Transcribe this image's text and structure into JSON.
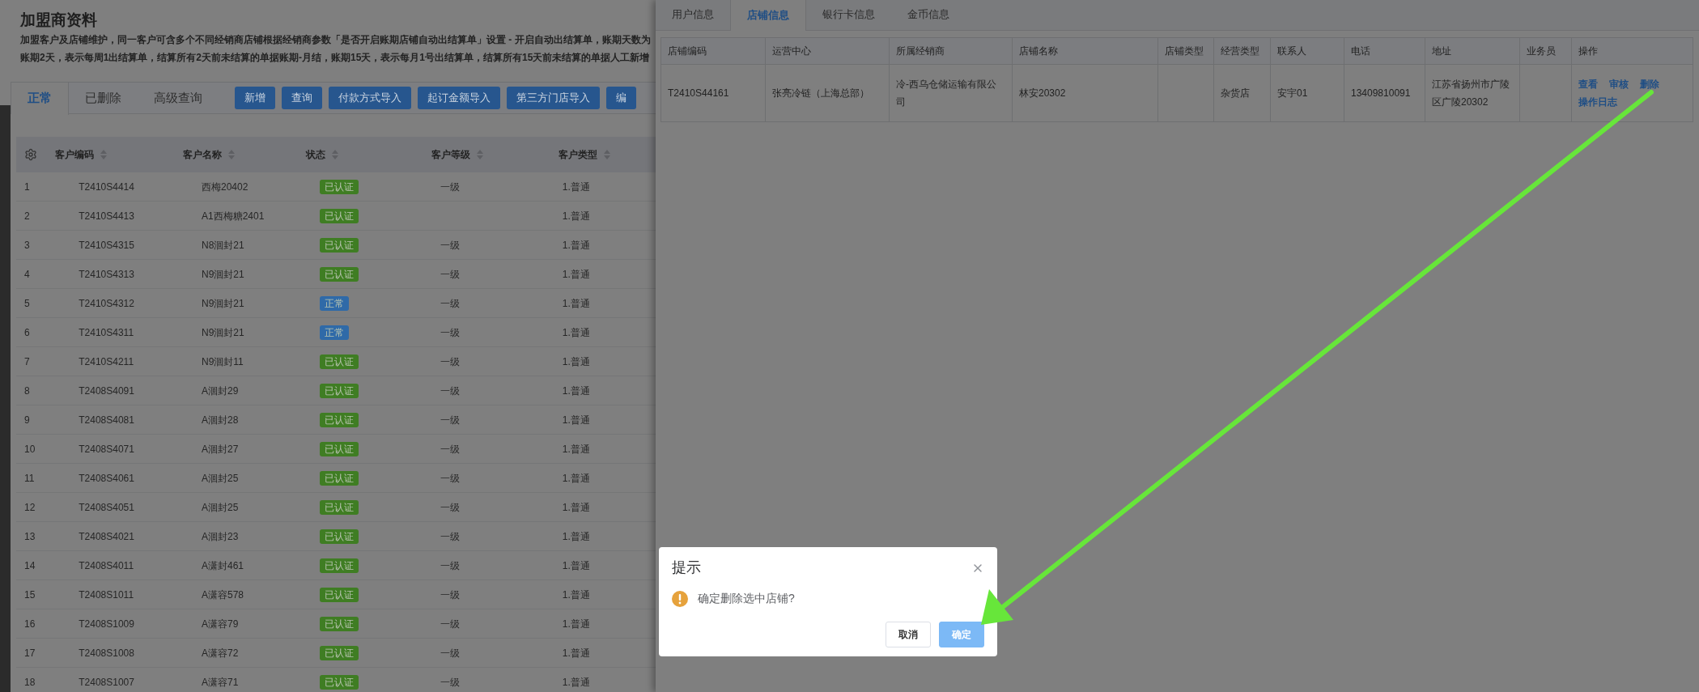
{
  "page": {
    "title": "加盟商资料",
    "description": [
      "加盟客户及店铺维护，同一客户可含多个不同经销商店铺根据经销商参数「是否开启账期店铺自动出结算单」设置 - 开启自动出结算单，账期天数为",
      "账期2天，表示每周1出结算单，结算所有2天前未结算的单据账期-月结，账期15天，表示每月1号出结算单，结算所有15天前未结算的单据人工新增"
    ],
    "tabs": [
      {
        "label": "正常",
        "selected": true
      },
      {
        "label": "已删除",
        "selected": false
      },
      {
        "label": "高级查询",
        "selected": false
      }
    ],
    "buttons": [
      "新增",
      "查询",
      "付款方式导入",
      "起订金额导入",
      "第三方门店导入",
      "编"
    ],
    "table": {
      "columns": [
        {
          "label": "客户编码",
          "sortable": true
        },
        {
          "label": "客户名称",
          "sortable": true
        },
        {
          "label": "状态",
          "sortable": true
        },
        {
          "label": "客户等级",
          "sortable": true
        },
        {
          "label": "客户类型",
          "sortable": true
        }
      ],
      "rows": [
        {
          "index": "1",
          "code": "T2410S4414",
          "name": "西梅20402",
          "status": {
            "label": "已认证",
            "kind": "certified"
          },
          "level": "一级",
          "type": "1.普通"
        },
        {
          "index": "2",
          "code": "T2410S4413",
          "name": "A1西梅糖2401",
          "status": {
            "label": "已认证",
            "kind": "certified"
          },
          "type": "1.普通"
        },
        {
          "index": "3",
          "code": "T2410S4315",
          "name": "N8洄封21",
          "status": {
            "label": "已认证",
            "kind": "certified"
          },
          "level": "一级",
          "type": "1.普通"
        },
        {
          "index": "4",
          "code": "T2410S4313",
          "name": "N9洄封21",
          "status": {
            "label": "已认证",
            "kind": "certified"
          },
          "level": "一级",
          "type": "1.普通"
        },
        {
          "index": "5",
          "code": "T2410S4312",
          "name": "N9洄封21",
          "status": {
            "label": "正常",
            "kind": "normal"
          },
          "level": "一级",
          "type": "1.普通"
        },
        {
          "index": "6",
          "code": "T2410S4311",
          "name": "N9洄封21",
          "status": {
            "label": "正常",
            "kind": "normal"
          },
          "level": "一级",
          "type": "1.普通"
        },
        {
          "index": "7",
          "code": "T2410S4211",
          "name": "N9洄封11",
          "status": {
            "label": "已认证",
            "kind": "certified"
          },
          "level": "一级",
          "type": "1.普通"
        },
        {
          "index": "8",
          "code": "T2408S4091",
          "name": "A洄封29",
          "status": {
            "label": "已认证",
            "kind": "certified"
          },
          "level": "一级",
          "type": "1.普通"
        },
        {
          "index": "9",
          "code": "T2408S4081",
          "name": "A洄封28",
          "status": {
            "label": "已认证",
            "kind": "certified"
          },
          "level": "一级",
          "type": "1.普通"
        },
        {
          "index": "10",
          "code": "T2408S4071",
          "name": "A洄封27",
          "status": {
            "label": "已认证",
            "kind": "certified"
          },
          "level": "一级",
          "type": "1.普通"
        },
        {
          "index": "11",
          "code": "T2408S4061",
          "name": "A洄封25",
          "status": {
            "label": "已认证",
            "kind": "certified"
          },
          "level": "一级",
          "type": "1.普通"
        },
        {
          "index": "12",
          "code": "T2408S4051",
          "name": "A洄封25",
          "status": {
            "label": "已认证",
            "kind": "certified"
          },
          "level": "一级",
          "type": "1.普通"
        },
        {
          "index": "13",
          "code": "T2408S4021",
          "name": "A洄封23",
          "status": {
            "label": "已认证",
            "kind": "certified"
          },
          "level": "一级",
          "type": "1.普通"
        },
        {
          "index": "14",
          "code": "T2408S4011",
          "name": "A潇封461",
          "status": {
            "label": "已认证",
            "kind": "certified"
          },
          "level": "一级",
          "type": "1.普通"
        },
        {
          "index": "15",
          "code": "T2408S1011",
          "name": "A潇容578",
          "status": {
            "label": "已认证",
            "kind": "certified"
          },
          "level": "一级",
          "type": "1.普通"
        },
        {
          "index": "16",
          "code": "T2408S1009",
          "name": "A潇容79",
          "status": {
            "label": "已认证",
            "kind": "certified"
          },
          "level": "一级",
          "type": "1.普通"
        },
        {
          "index": "17",
          "code": "T2408S1008",
          "name": "A潇容72",
          "status": {
            "label": "已认证",
            "kind": "certified"
          },
          "level": "一级",
          "type": "1.普通"
        },
        {
          "index": "18",
          "code": "T2408S1007",
          "name": "A潇容71",
          "status": {
            "label": "已认证",
            "kind": "certified"
          },
          "level": "一级",
          "type": "1.普通"
        }
      ]
    }
  },
  "drawer": {
    "tabs": [
      {
        "label": "用户信息",
        "selected": false
      },
      {
        "label": "店铺信息",
        "selected": true
      },
      {
        "label": "银行卡信息",
        "selected": false
      },
      {
        "label": "金币信息",
        "selected": false
      }
    ],
    "table": {
      "columns": [
        "店铺编码",
        "运营中心",
        "所属经销商",
        "店铺名称",
        "店铺类型",
        "经营类型",
        "联系人",
        "电话",
        "地址",
        "业务员",
        "操作"
      ],
      "rows": [
        {
          "cells": [
            "T2410S44161",
            "张亮冷链（上海总部）",
            "冷-西乌仓储运输有限公司",
            "林安20302",
            "",
            "杂货店",
            "安宇01",
            "13409810091",
            "江苏省扬州市广陵区广陵20302",
            ""
          ],
          "actions": [
            "查看",
            "审核",
            "删除",
            "操作日志"
          ]
        }
      ]
    }
  },
  "dialog": {
    "title": "提示",
    "message": "确定删除选中店铺?",
    "buttons": [
      {
        "label": "取消",
        "kind": "secondary"
      },
      {
        "label": "确定",
        "kind": "primary"
      }
    ]
  }
}
